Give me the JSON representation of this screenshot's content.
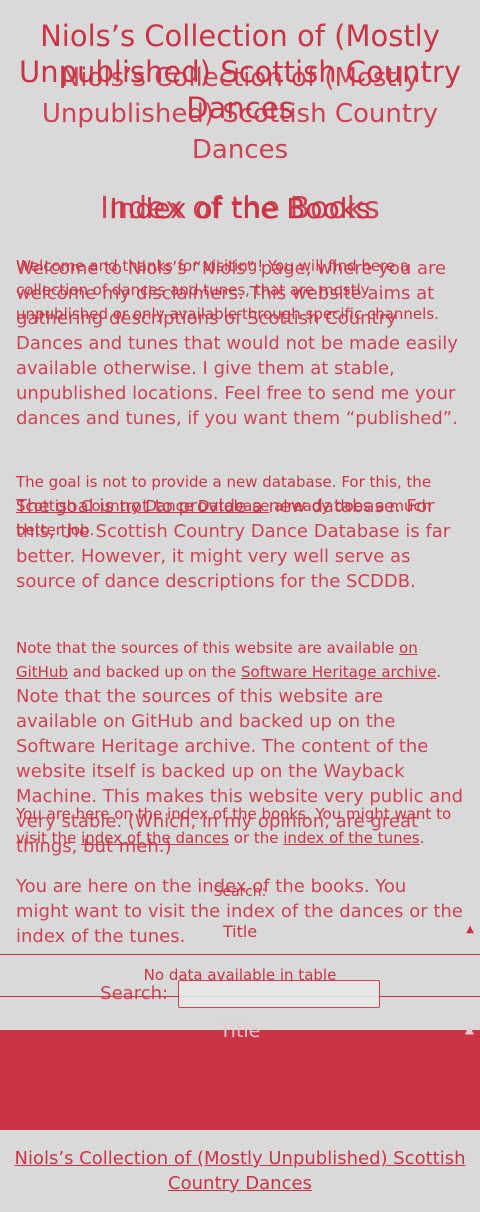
{
  "site": {
    "title": "Niols’s Collection of (Mostly Unpublished) Scottish Country Dances"
  },
  "page": {
    "heading": "Index of the Books"
  },
  "intro": {
    "welcome": "Welcome and thanks for visiting! You will find here a collection of dances and tunes, that are mostly unpublished or only available through specific channels.",
    "goal_prefix": "The goal is not to provide a new database. For this, the ",
    "scddb_link": "Scottish Country Dance Database",
    "goal_suffix": " already does a much better job.",
    "sources_prefix": "Note that the sources of this website are available ",
    "github_link": "on GitHub",
    "sources_middle": " and backed up on the ",
    "swh_link": "Software Heritage archive",
    "sources_suffix": ".",
    "you_are_here_prefix": "You are here on the index of the books. You might want to visit the ",
    "dances_link": "index of the dances",
    "you_are_here_middle": " or the ",
    "tunes_link": "index of the tunes",
    "you_are_here_suffix": "."
  },
  "table": {
    "search_label": "Search:",
    "column_title": "Title",
    "empty_message": "No data available in table",
    "sort_glyph": "▲"
  },
  "overlay": {
    "welcome": "Welcome to Niols’s “Niols” page, where you are welcome my disclaimers. This website aims at gathering descriptions of Scottish Country Dances and tunes that would not be made easily available otherwise. I give them at stable, unpublished locations. Feel free to send me your dances and tunes, if you want them “published”.",
    "goal": "The goal is not to provide a new database. For this, the Scottish Country Dance Database is far better. However, it might very well serve as source of dance descriptions for the SCDDB.",
    "sources": "Note that the sources of this website are available on GitHub and backed up on the Software Heritage archive. The content of the website itself is backed up on the Wayback Machine. This makes this website very public and very stable. (Which, in my opinion, are great things, but meh.)",
    "you_are_here": "You are here on the index of the books. You might want to visit the index of the dances or the index of the tunes."
  },
  "footer": {
    "link": "Niols’s Collection of (Mostly Unpublished) Scottish Country Dances"
  },
  "colors": {
    "background": "#d9d9d9",
    "accent": "#cc3344"
  }
}
